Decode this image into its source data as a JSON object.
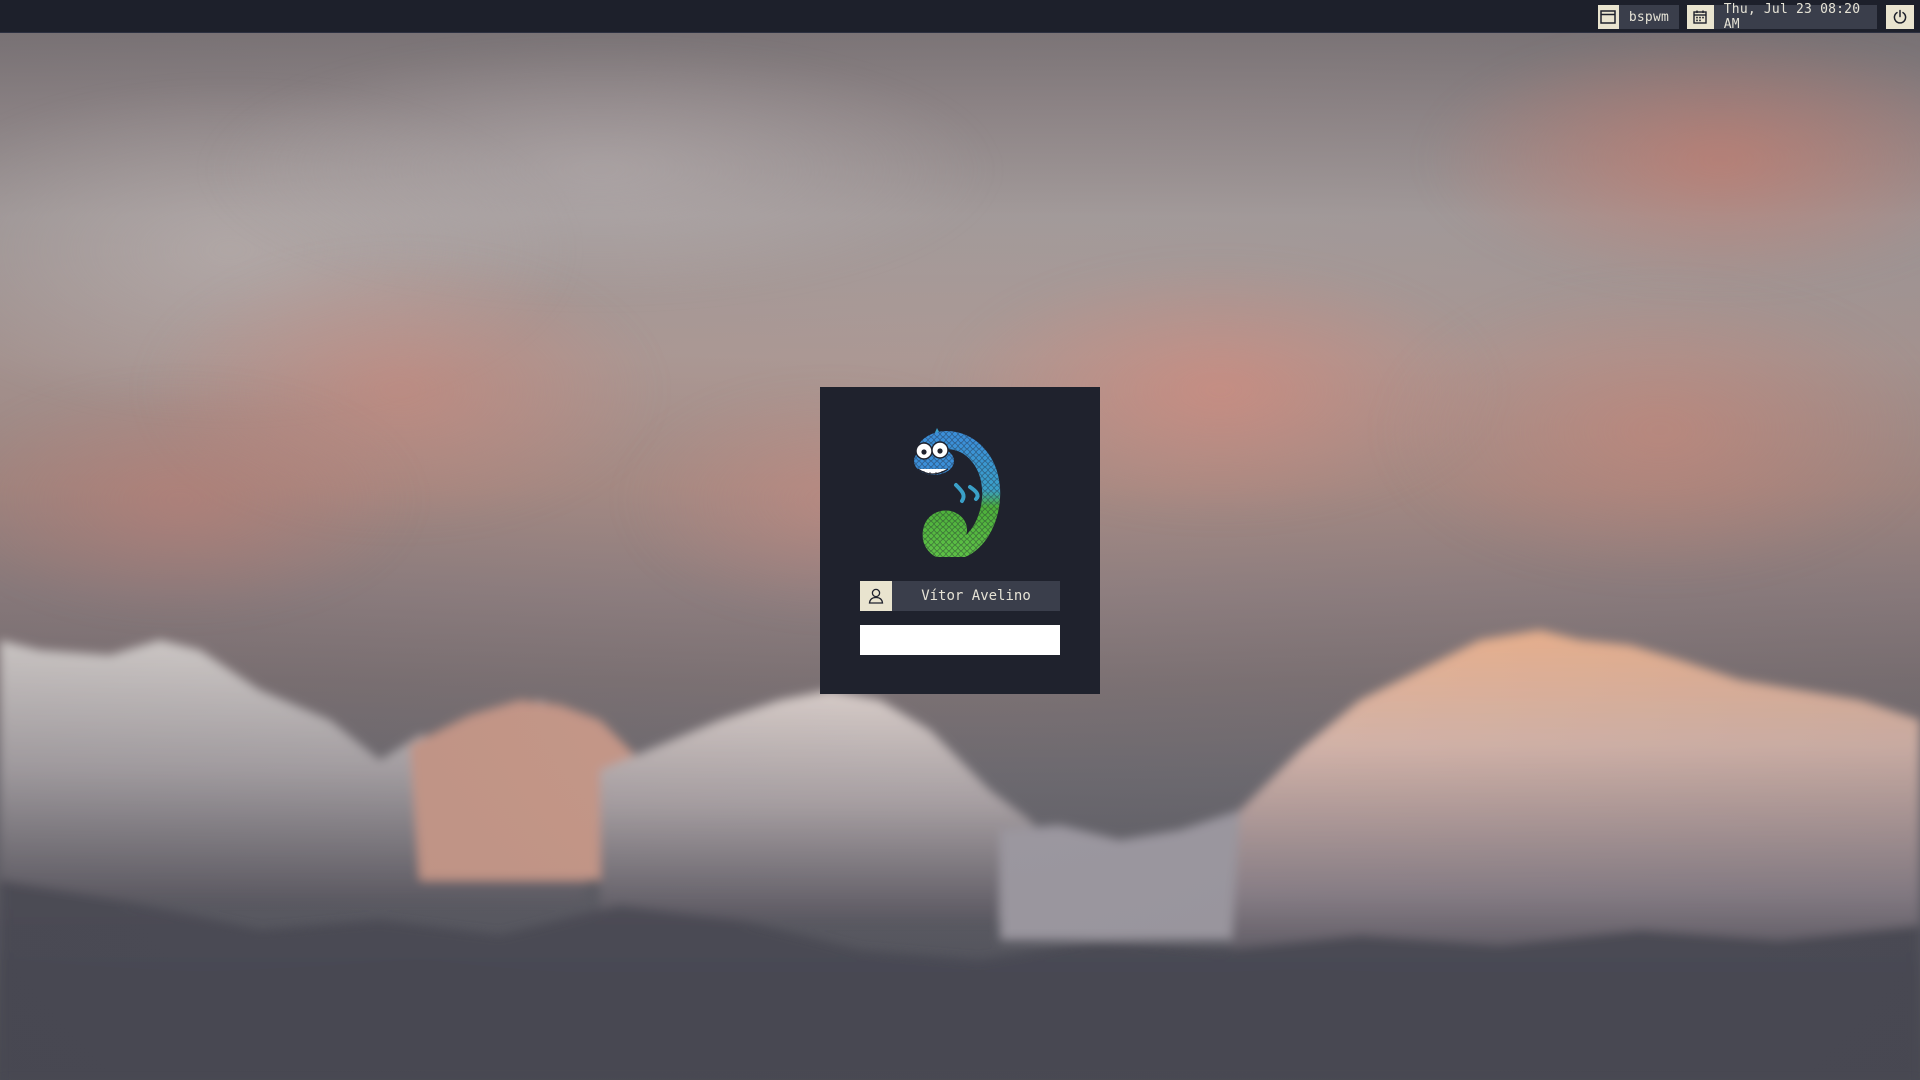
{
  "topbar": {
    "window_manager": {
      "icon": "window-icon",
      "label": "bspwm"
    },
    "clock": {
      "icon": "calendar-icon",
      "label": "Thu, Jul 23 08:20 AM"
    },
    "power": {
      "icon": "power-icon"
    }
  },
  "login": {
    "logo_icon": "chameleon-logo-icon",
    "user": {
      "icon": "user-icon",
      "name": "Vítor Avelino"
    },
    "password": {
      "value": "",
      "placeholder": ""
    }
  },
  "colors": {
    "bar_background": "#1d202b",
    "module_background": "#3a3e4b",
    "icon_background": "#e9e4cf",
    "panel_background": "#1f222d",
    "text": "#e6e3d6",
    "logo_blue": "#3b8fd9",
    "logo_green": "#4caf3a"
  }
}
